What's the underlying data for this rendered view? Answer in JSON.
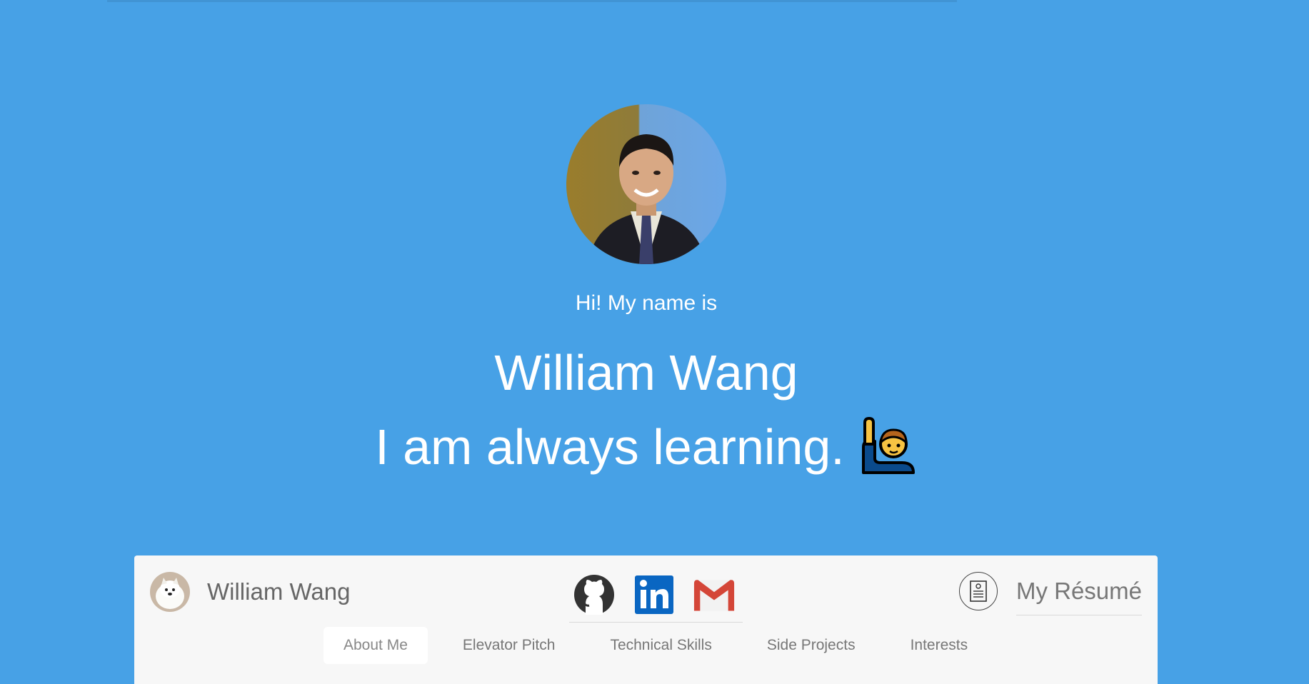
{
  "hero": {
    "greeting": "Hi! My name is",
    "name": "William Wang",
    "tagline": "I am always learning."
  },
  "navbar": {
    "brand_name": "William Wang",
    "socials": [
      {
        "icon": "github-icon",
        "label": "GitHub"
      },
      {
        "icon": "linkedin-icon",
        "label": "LinkedIn"
      },
      {
        "icon": "gmail-icon",
        "label": "Gmail"
      }
    ],
    "resume_label": "My Résumé",
    "tabs": [
      {
        "label": "About Me",
        "active": true
      },
      {
        "label": "Elevator Pitch",
        "active": false
      },
      {
        "label": "Technical Skills",
        "active": false
      },
      {
        "label": "Side Projects",
        "active": false
      },
      {
        "label": "Interests",
        "active": false
      }
    ]
  },
  "colors": {
    "background": "#47a1e6",
    "card": "#f7f7f7",
    "linkedin": "#0a66c2",
    "gmail_red": "#d44638",
    "github_dark": "#333333"
  }
}
